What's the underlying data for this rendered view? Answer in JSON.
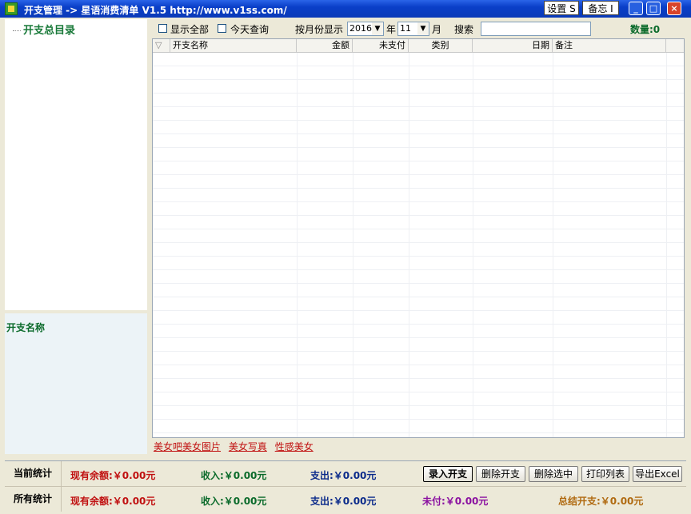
{
  "window": {
    "title": "开支管理 -> 星语消费清单 V1.5 http://www.v1ss.com/",
    "settings_label": "设置 S",
    "memo_label": "备忘 I",
    "minimize": "_",
    "maximize": "□",
    "close": "×"
  },
  "tree": {
    "root_label": "开支总目录"
  },
  "detail": {
    "label": "开支名称"
  },
  "filter": {
    "show_all": "显示全部",
    "today": "今天查询",
    "by_month": "按月份显示",
    "year_value": "2016",
    "year_unit": "年",
    "month_value": "11",
    "month_unit": "月",
    "search_label": "搜索",
    "search_value": "",
    "count_text": "数量:0"
  },
  "table": {
    "sort_glyph": "▽",
    "columns": [
      "开支名称",
      "金额",
      "未支付",
      "类别",
      "日期",
      "备注"
    ],
    "rows": []
  },
  "ad_links": [
    "美女吧美女图片",
    "美女写真",
    "性感美女"
  ],
  "stats": {
    "current": {
      "caption": "当前统计",
      "balance": "现有余额:￥0.00元",
      "income": "收入:￥0.00元",
      "expense": "支出:￥0.00元"
    },
    "all": {
      "caption": "所有统计",
      "balance": "现有余额:￥0.00元",
      "income": "收入:￥0.00元",
      "expense": "支出:￥0.00元",
      "unpaid": "未付:￥0.00元",
      "total": "总结开支:￥0.00元"
    }
  },
  "actions": {
    "add": "录入开支",
    "delete": "删除开支",
    "delete_selected": "删除选中",
    "print": "打印列表",
    "export": "导出Excel"
  },
  "colors": {
    "titlebar": "#0a3fc8",
    "red": "#c01010",
    "green": "#0a6a2a",
    "blue": "#0a2a8a",
    "purple": "#8a10a0",
    "orange": "#b06a10"
  }
}
